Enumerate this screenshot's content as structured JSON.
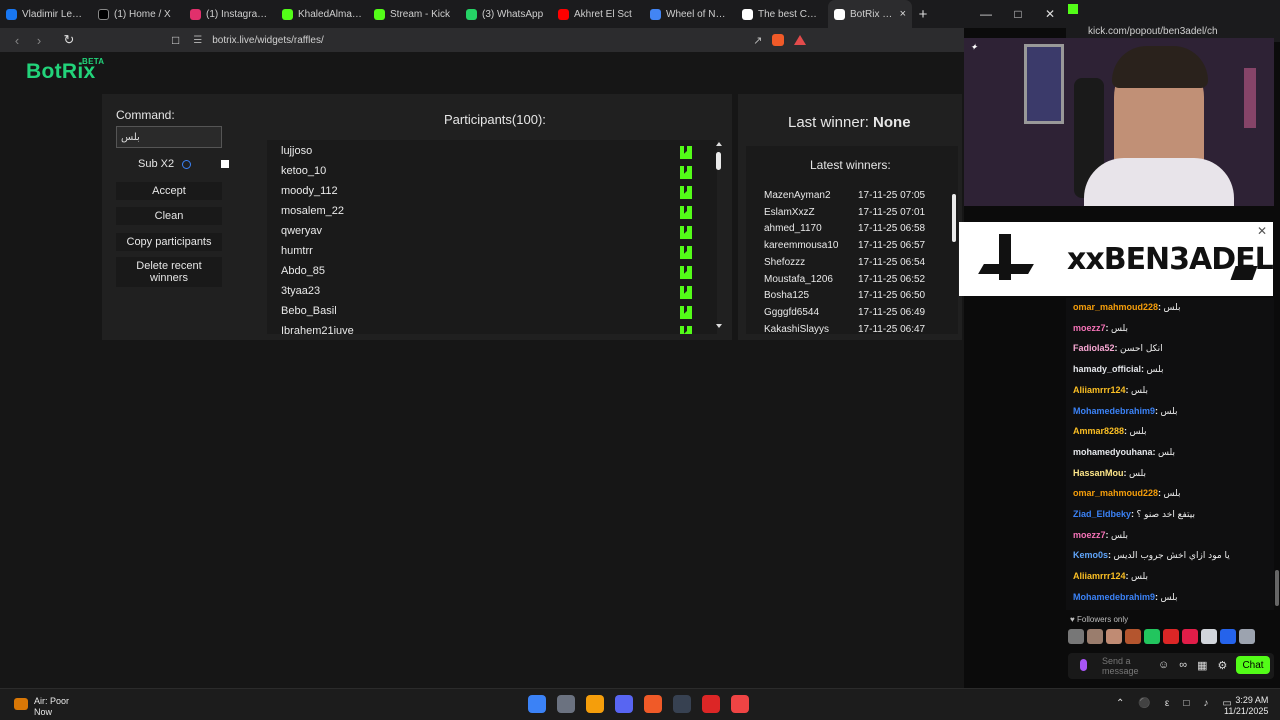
{
  "browser": {
    "tabs": [
      {
        "label": "Vladimir Lenin m",
        "color": "#1877f2"
      },
      {
        "label": "(1) Home / X",
        "color": "#000000"
      },
      {
        "label": "(1) Instagram • M",
        "color": "#e1306c"
      },
      {
        "label": "KhaledAlmasry S",
        "color": "#53fc18"
      },
      {
        "label": "Stream - Kick",
        "color": "#53fc18"
      },
      {
        "label": "(3) WhatsApp",
        "color": "#25d366"
      },
      {
        "label": "Akhret El Sct",
        "color": "#ff0000"
      },
      {
        "label": "Wheel of Names",
        "color": "#4285f4"
      },
      {
        "label": "The best ChatBo",
        "color": "#ffffff"
      },
      {
        "label": "BotRix | Giv",
        "color": "#ffffff",
        "active": true
      }
    ],
    "new_tab": "+",
    "url": "botrix.live/widgets/raffles/"
  },
  "botrix": {
    "brand": "BotRix",
    "beta": "BETA",
    "command_label": "Command:",
    "command_value": "بلس",
    "sub_label": "Sub X2",
    "buttons": {
      "accept": "Accept",
      "clean": "Clean",
      "copy": "Copy participants",
      "delete": "Delete recent winners"
    },
    "participants_title": "Participants(100):",
    "participants": [
      "lujjoso",
      "ketoo_10",
      "moody_112",
      "mosalem_22",
      "qweryav",
      "humtrr",
      "Abdo_85",
      "3tyaa23",
      "Bebo_Basil",
      "Ibrahem21juve"
    ],
    "last_winner_label": "Last winner:",
    "last_winner_value": "None",
    "latest_winners_title": "Latest winners:",
    "latest_winners": [
      {
        "name": "MazenAyman2",
        "time": "17-11-25 07:05"
      },
      {
        "name": "EslamXxzZ",
        "time": "17-11-25 07:01"
      },
      {
        "name": "ahmed_1170",
        "time": "17-11-25 06:58"
      },
      {
        "name": "kareemmousa10",
        "time": "17-11-25 06:57"
      },
      {
        "name": "Shefozzz",
        "time": "17-11-25 06:54"
      },
      {
        "name": "Moustafa_1206",
        "time": "17-11-25 06:52"
      },
      {
        "name": "Bosha125",
        "time": "17-11-25 06:50"
      },
      {
        "name": "Ggggfd6544",
        "time": "17-11-25 06:49"
      },
      {
        "name": "KakashiSlayys",
        "time": "17-11-25 06:47"
      }
    ]
  },
  "kick": {
    "popout_url": "kick.com/popout/ben3adel/ch",
    "banner_text": "xxBEN3ADEL",
    "messages": [
      {
        "user": "omar_mahmoud228",
        "text": "بلس",
        "color": "#f59e0b"
      },
      {
        "user": "moezz7",
        "text": "بلس",
        "color": "#f472b6"
      },
      {
        "user": "Fadiola52",
        "text": "انكل احسن",
        "color": "#f9a8d4"
      },
      {
        "user": "hamady_official",
        "text": "بلس",
        "color": "#e5e7eb"
      },
      {
        "user": "Aliiamrrr124",
        "text": "بلس",
        "color": "#fbbf24"
      },
      {
        "user": "Mohamedebrahim9",
        "text": "بلس",
        "color": "#3b82f6"
      },
      {
        "user": "Ammar8288",
        "text": "بلس",
        "color": "#fbbf24"
      },
      {
        "user": "mohamedyouhana",
        "text": "بلس",
        "color": "#e5e7eb"
      },
      {
        "user": "HassanMou",
        "text": "بلس",
        "color": "#fde68a"
      },
      {
        "user": "omar_mahmoud228",
        "text": "بلس",
        "color": "#f59e0b"
      },
      {
        "user": "Ziad_Eldbeky",
        "text": "بيتفع اخد صنو ؟",
        "color": "#3b82f6"
      },
      {
        "user": "moezz7",
        "text": "بلس",
        "color": "#f472b6"
      },
      {
        "user": "Kemo0s",
        "text": "يا مود ازاي اخش جروب الديس",
        "color": "#60a5fa"
      },
      {
        "user": "Aliiamrrr124",
        "text": "بلس",
        "color": "#fbbf24"
      },
      {
        "user": "Mohamedebrahim9",
        "text": "بلس",
        "color": "#3b82f6"
      }
    ],
    "followers_only": "Followers only",
    "send_placeholder": "Send a message",
    "chat_button": "Chat"
  },
  "taskbar": {
    "weather_title": "Air: Poor",
    "weather_sub": "Now",
    "time": "3:29 AM",
    "date": "11/21/2025"
  }
}
